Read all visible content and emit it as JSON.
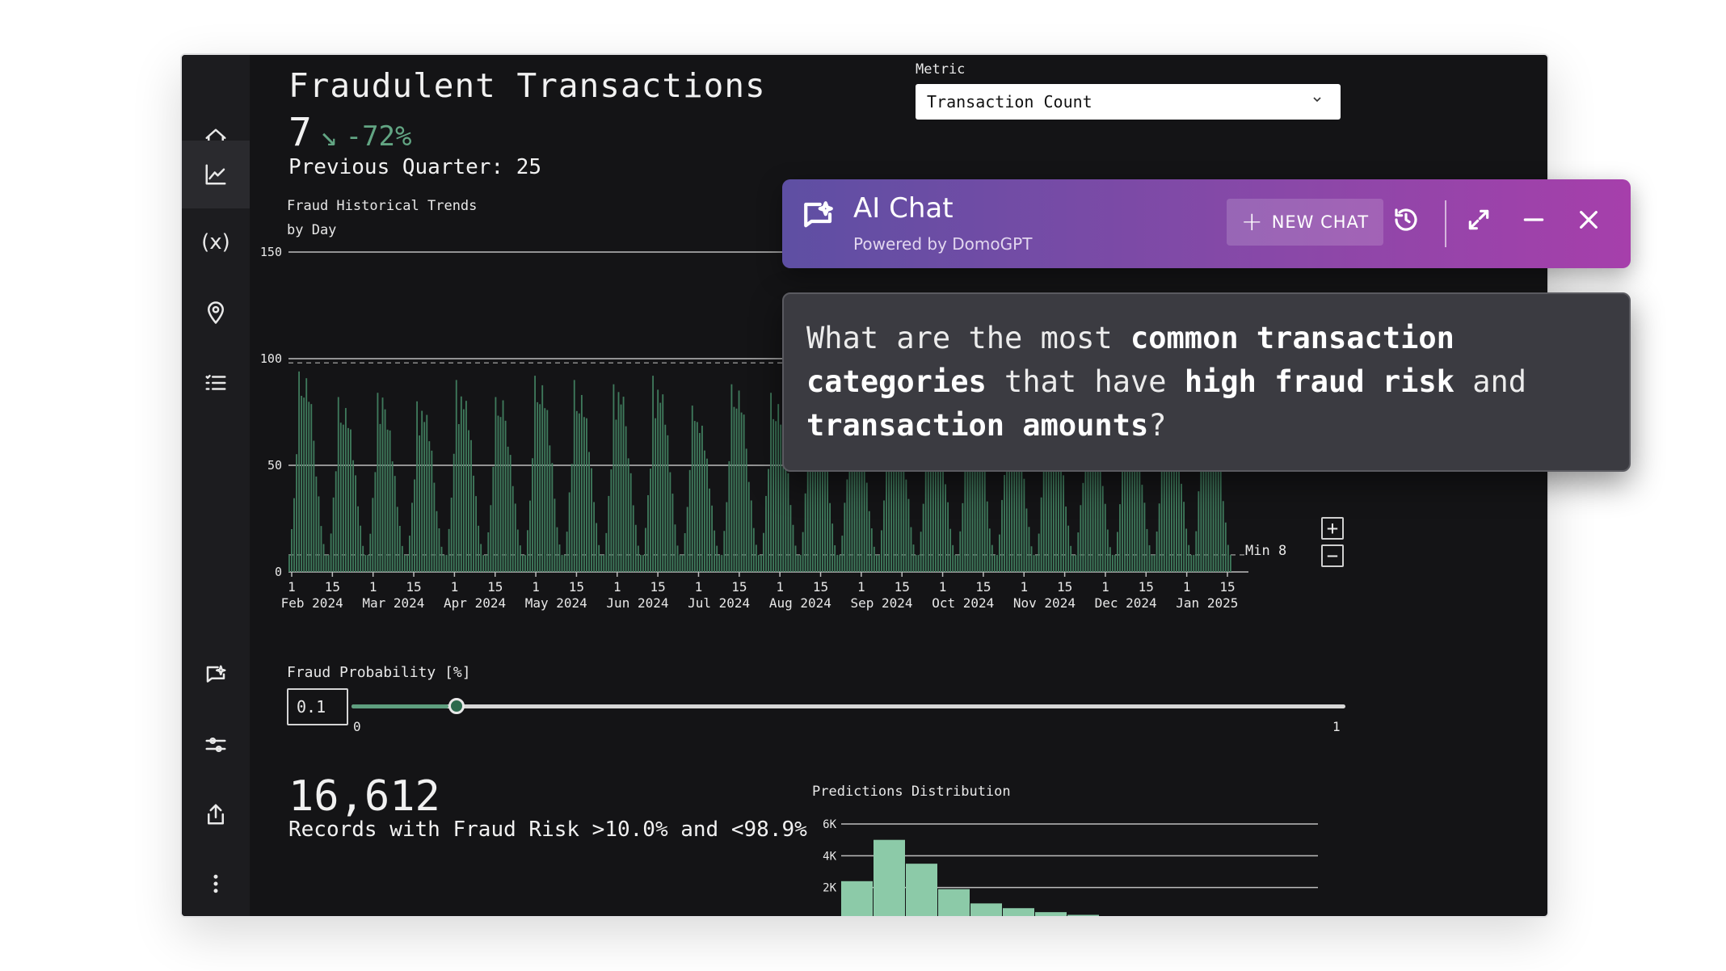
{
  "dashboard": {
    "title": "Fraudulent Transactions",
    "kpi_value": "7",
    "kpi_arrow": "↘",
    "kpi_change": "-72%",
    "previous": "Previous Quarter: 25",
    "metric_label": "Metric",
    "metric_value": "Transaction Count",
    "chart_title_line1": "Fraud Historical Trends",
    "chart_title_line2": "by Day",
    "min_label": "Min 8",
    "zoom_in": "+",
    "zoom_out": "−",
    "prob_label": "Fraud Probability [%]",
    "prob_value": "0.1",
    "slider_min": "0",
    "slider_max": "1",
    "slider_value": 0.1,
    "big_count": "16,612",
    "big_desc": "Records with Fraud Risk >10.0% and <98.9%",
    "dist_title": "Predictions Distribution"
  },
  "chat": {
    "title": "AI Chat",
    "subtitle": "Powered by DomoGPT",
    "new_chat": "NEW CHAT",
    "message": {
      "p1": "What are the most ",
      "b1": "common transaction categories",
      "p2": " that have ",
      "b2": "high fraud risk",
      "p3": " and ",
      "b3": "transaction amounts",
      "p4": "?"
    }
  },
  "colors": {
    "accent_green": "#62a583",
    "bar_green": "#3f7a5c",
    "chat_purple_start": "#5e4fa3",
    "chat_purple_end": "#a63fab"
  },
  "chart_data": [
    {
      "type": "bar",
      "title": "Fraud Historical Trends",
      "subtitle": "by Day",
      "ylim": [
        0,
        150
      ],
      "yticks": [
        "0",
        "50",
        "100",
        "150"
      ],
      "x_ticks": [
        "1",
        "15",
        "1",
        "15",
        "1",
        "15",
        "1",
        "15",
        "1",
        "15",
        "1",
        "15",
        "1",
        "15",
        "1",
        "15",
        "1",
        "15",
        "1",
        "15",
        "1",
        "15",
        "1",
        "15"
      ],
      "x_months": [
        "Feb 2024",
        "Mar 2024",
        "Apr 2024",
        "May 2024",
        "Jun 2024",
        "Jul 2024",
        "Aug 2024",
        "Sep 2024",
        "Oct 2024",
        "Nov 2024",
        "Dec 2024",
        "Jan 2025"
      ],
      "peaks": [
        94,
        82,
        84,
        80,
        90,
        82,
        92,
        90,
        88,
        92,
        78,
        88,
        84,
        90,
        80,
        86,
        84,
        88,
        80,
        86,
        78,
        82,
        86,
        90
      ],
      "annotations": [
        "Min 8"
      ]
    },
    {
      "type": "bar",
      "title": "Predictions Distribution",
      "yticks": [
        "2K",
        "4K",
        "6K"
      ],
      "values": [
        2400,
        5000,
        3500,
        1900,
        1000,
        700,
        450,
        280
      ]
    }
  ]
}
